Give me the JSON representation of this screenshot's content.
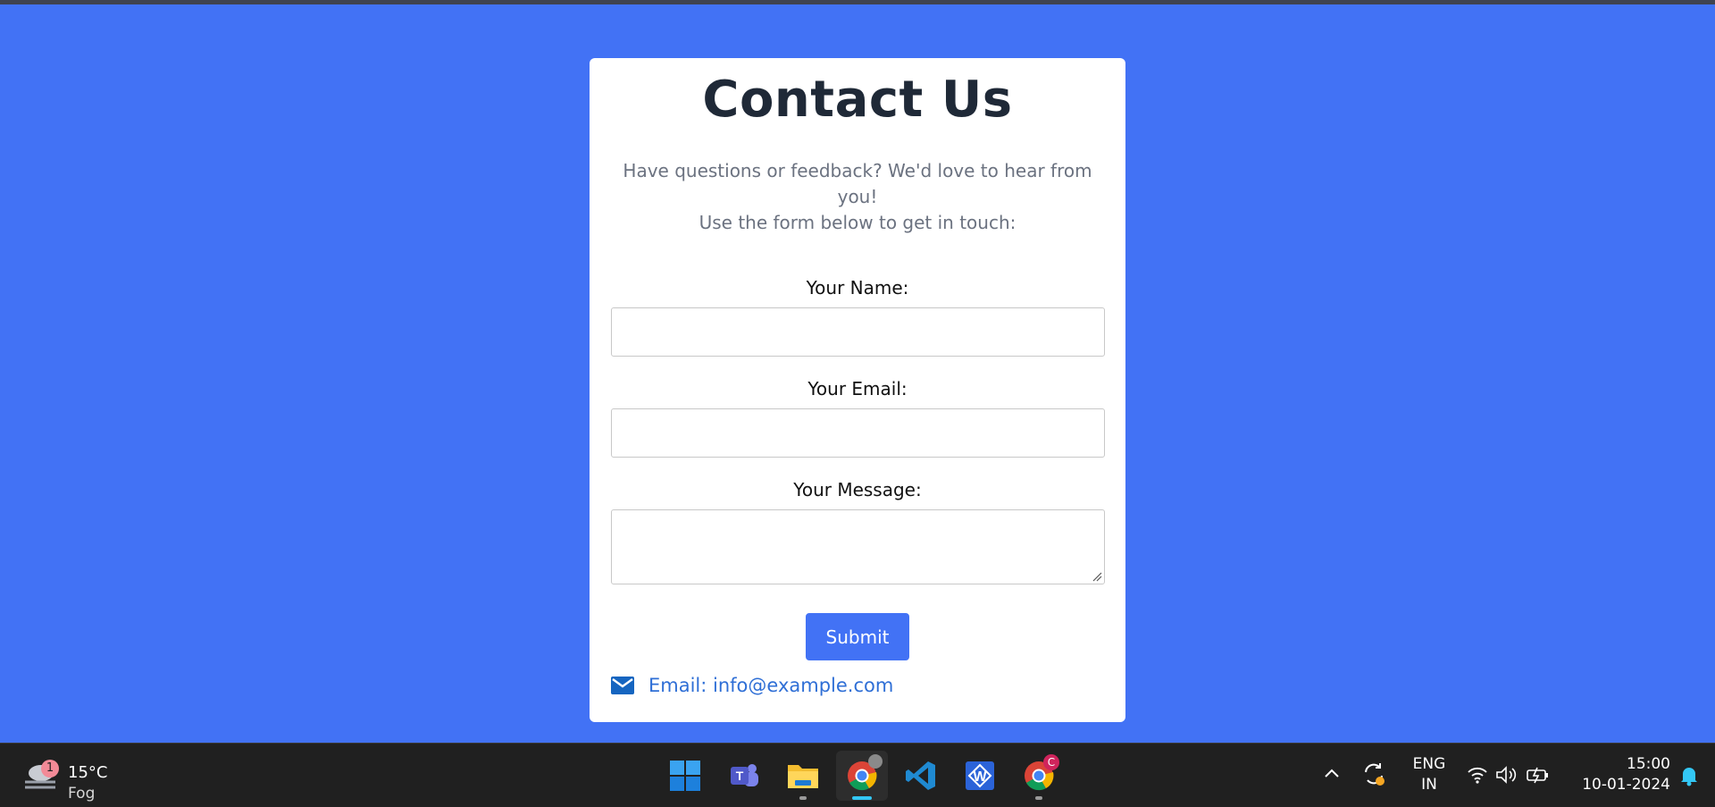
{
  "page": {
    "title": "Contact Us",
    "intro_line1": "Have questions or feedback? We'd love to hear from you!",
    "intro_line2": "Use the form below to get in touch:"
  },
  "form": {
    "name_label": "Your Name:",
    "name_value": "",
    "email_label": "Your Email:",
    "email_value": "",
    "message_label": "Your Message:",
    "message_value": "",
    "submit_label": "Submit"
  },
  "contact": {
    "email_text": "Email: info@example.com",
    "icon": "mail-icon"
  },
  "colors": {
    "background": "#4272f5",
    "accent": "#4272f5",
    "link": "#2f6fd6",
    "title": "#1f2937"
  },
  "taskbar": {
    "weather": {
      "temperature": "15°C",
      "condition": "Fog",
      "badge": "1"
    },
    "apps": [
      {
        "name": "start",
        "icon": "windows-icon"
      },
      {
        "name": "teams",
        "icon": "teams-icon"
      },
      {
        "name": "file-explorer",
        "icon": "folder-icon"
      },
      {
        "name": "chrome",
        "icon": "chrome-icon"
      },
      {
        "name": "vscode",
        "icon": "vscode-icon"
      },
      {
        "name": "wps-writer",
        "icon": "writer-icon"
      },
      {
        "name": "chrome-profile",
        "icon": "chrome-icon",
        "badge": "C"
      }
    ],
    "language_line1": "ENG",
    "language_line2": "IN",
    "time": "15:00",
    "date": "10-01-2024"
  }
}
